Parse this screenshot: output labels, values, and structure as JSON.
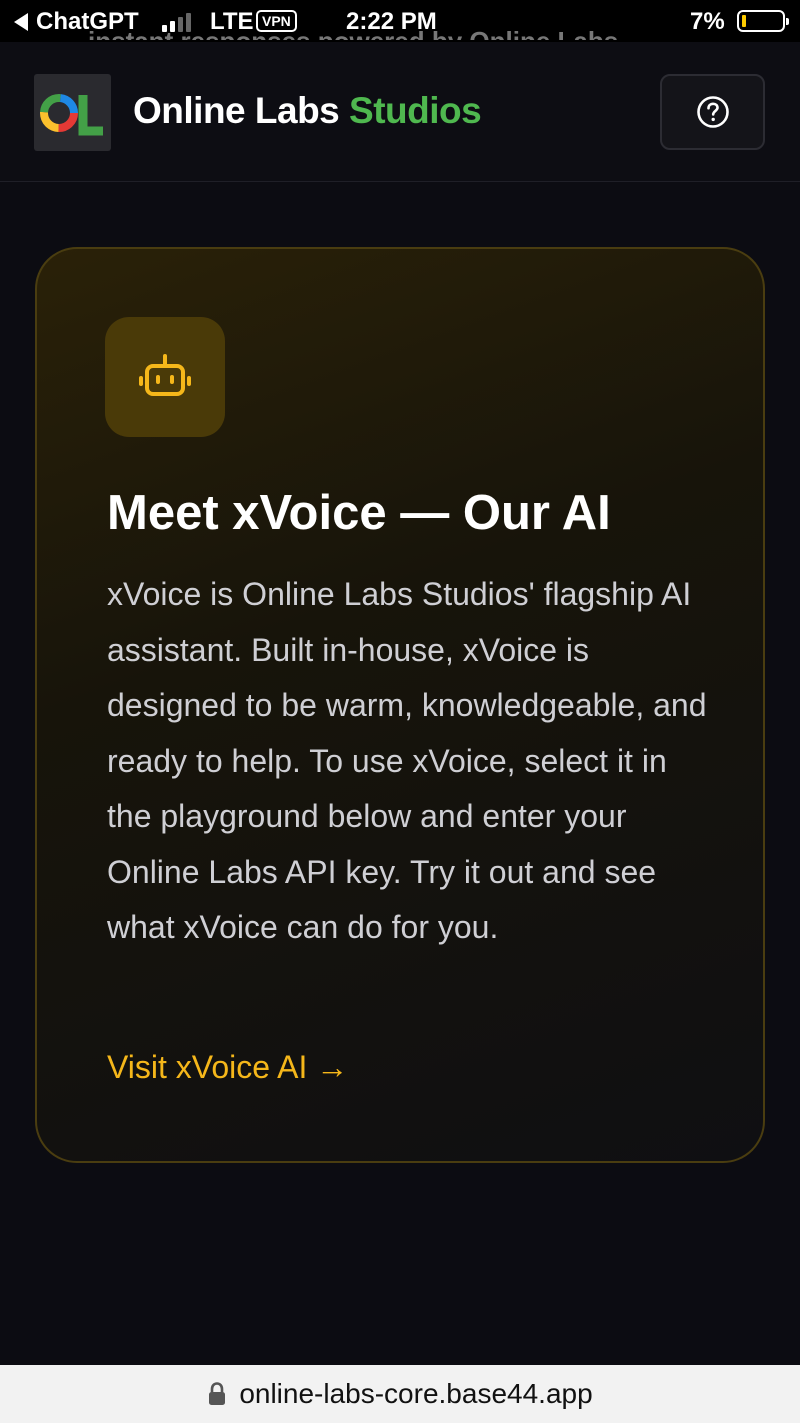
{
  "status_bar": {
    "back_app": "ChatGPT",
    "network": "LTE",
    "vpn": "VPN",
    "time": "2:22 PM",
    "battery_percent": "7%",
    "battery_level": 0.07
  },
  "header": {
    "cutoff_text": "instant responses powered by Online Labs.",
    "logo_text": "OL",
    "brand_name": "Online Labs",
    "brand_accent": "Studios",
    "help_icon": "question-circle-icon"
  },
  "card": {
    "icon": "bot-icon",
    "title": "Meet xVoice — Our AI",
    "body": "xVoice is Online Labs Studios' flagship AI assistant. Built in-house, xVoice is designed to be warm, knowledgeable, and ready to help. To use xVoice, select it in the playground below and enter your Online Labs API key. Try it out and see what xVoice can do for you.",
    "link_label": "Visit xVoice AI →"
  },
  "url_bar": {
    "lock_icon": "lock-icon",
    "url": "online-labs-core.base44.app"
  },
  "colors": {
    "accent_green": "#4fb84f",
    "accent_gold": "#f5b71a",
    "background": "#0c0c12"
  }
}
